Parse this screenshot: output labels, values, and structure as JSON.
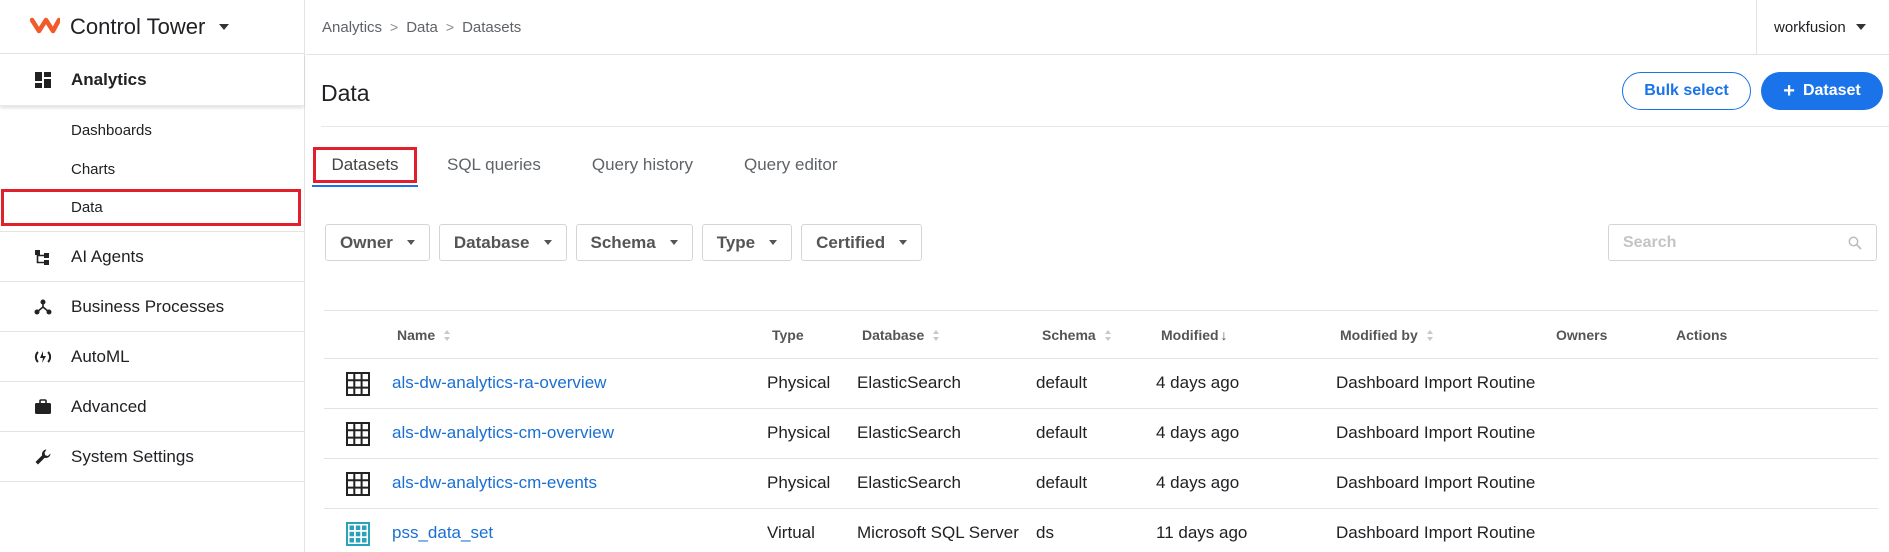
{
  "app": {
    "name": "Control Tower",
    "user": "workfusion",
    "brand_color": "#f15a29"
  },
  "breadcrumb": [
    "Analytics",
    "Data",
    "Datasets"
  ],
  "sidebar": {
    "items": [
      {
        "label": "Analytics",
        "icon": "dashboard-grid-icon",
        "active": true
      },
      {
        "label": "AI Agents",
        "icon": "hierarchy-icon"
      },
      {
        "label": "Business Processes",
        "icon": "process-nodes-icon"
      },
      {
        "label": "AutoML",
        "icon": "automl-icon"
      },
      {
        "label": "Advanced",
        "icon": "briefcase-icon"
      },
      {
        "label": "System Settings",
        "icon": "wrench-icon"
      }
    ],
    "subitems": [
      {
        "label": "Dashboards"
      },
      {
        "label": "Charts"
      },
      {
        "label": "Data",
        "highlighted": true
      }
    ]
  },
  "page": {
    "title": "Data",
    "bulk_select_label": "Bulk select",
    "add_dataset_label": "Dataset"
  },
  "tabs": [
    {
      "label": "Datasets",
      "active": true
    },
    {
      "label": "SQL queries"
    },
    {
      "label": "Query history"
    },
    {
      "label": "Query editor"
    }
  ],
  "filters": [
    "Owner",
    "Database",
    "Schema",
    "Type",
    "Certified"
  ],
  "search": {
    "placeholder": "Search"
  },
  "table": {
    "columns": [
      "Name",
      "Type",
      "Database",
      "Schema",
      "Modified",
      "Modified by",
      "Owners",
      "Actions"
    ],
    "rows": [
      {
        "icon": "table-grid-icon",
        "name": "als-dw-analytics-ra-overview",
        "type": "Physical",
        "database": "ElasticSearch",
        "schema": "default",
        "modified": "4 days ago",
        "modified_by": "Dashboard Import Routine"
      },
      {
        "icon": "table-grid-icon",
        "name": "als-dw-analytics-cm-overview",
        "type": "Physical",
        "database": "ElasticSearch",
        "schema": "default",
        "modified": "4 days ago",
        "modified_by": "Dashboard Import Routine"
      },
      {
        "icon": "table-grid-icon",
        "name": "als-dw-analytics-cm-events",
        "type": "Physical",
        "database": "ElasticSearch",
        "schema": "default",
        "modified": "4 days ago",
        "modified_by": "Dashboard Import Routine"
      },
      {
        "icon": "virtual-dataset-icon",
        "name": "pss_data_set",
        "type": "Virtual",
        "database": "Microsoft SQL Server",
        "schema": "ds",
        "modified": "11 days ago",
        "modified_by": "Dashboard Import Routine"
      }
    ]
  },
  "colors": {
    "accent": "#1a73e8",
    "link": "#1a6fd3",
    "highlight_box": "#e0202a",
    "virtual_icon": "#2aa3b8"
  }
}
